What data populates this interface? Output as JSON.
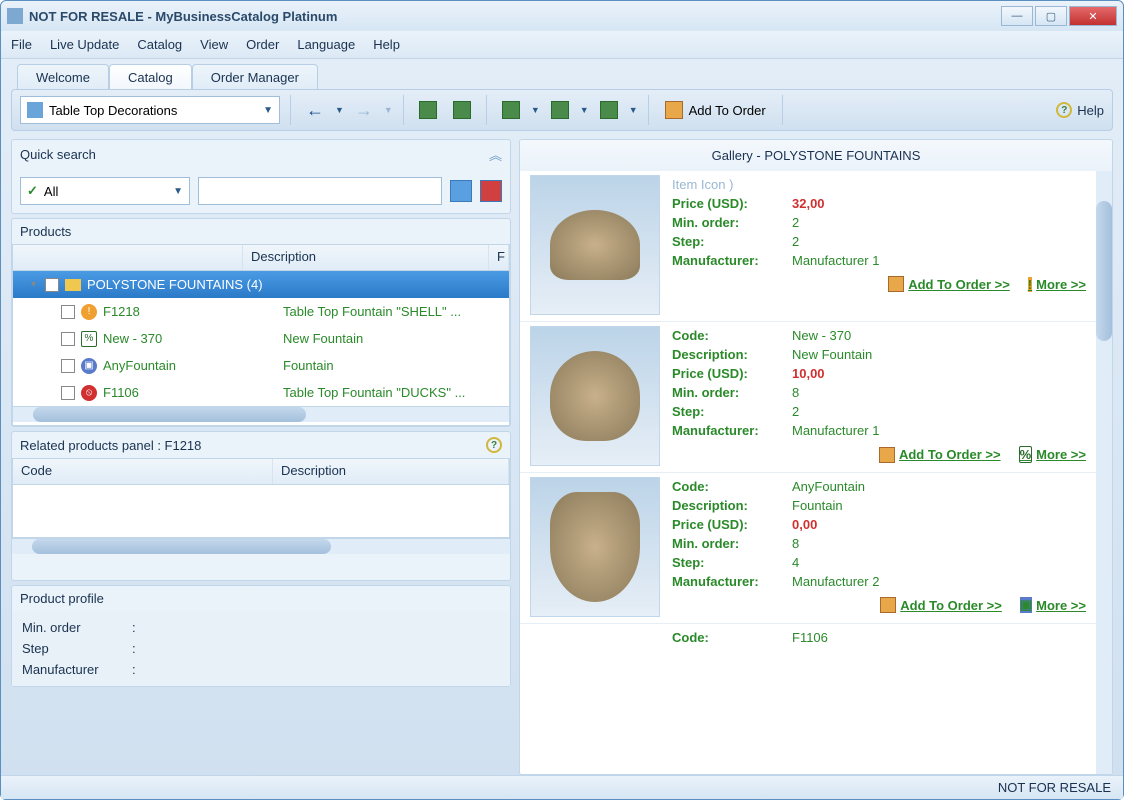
{
  "window": {
    "title": "NOT FOR RESALE - MyBusinessCatalog Platinum"
  },
  "menu": [
    "File",
    "Live Update",
    "Catalog",
    "View",
    "Order",
    "Language",
    "Help"
  ],
  "tabs": {
    "welcome": "Welcome",
    "catalog": "Catalog",
    "order_manager": "Order Manager"
  },
  "toolbar": {
    "category": "Table Top Decorations",
    "add_to_order": "Add To Order",
    "help": "Help"
  },
  "quick_search": {
    "title": "Quick search",
    "filter": "All"
  },
  "products": {
    "title": "Products",
    "col_name": "",
    "col_desc": "Description",
    "col_f": "F",
    "folder": "POLYSTONE FOUNTAINS   (4)",
    "rows": [
      {
        "code": "F1218",
        "desc": "Table Top Fountain \"SHELL\"   ...",
        "icon": "warn"
      },
      {
        "code": "New - 370",
        "desc": "New Fountain",
        "icon": "pct"
      },
      {
        "code": "AnyFountain",
        "desc": "Fountain",
        "icon": "ship"
      },
      {
        "code": "F1106",
        "desc": "Table Top Fountain \"DUCKS\"   ...",
        "icon": "stop"
      }
    ]
  },
  "related": {
    "title": "Related products panel : F1218",
    "col_code": "Code",
    "col_desc": "Description"
  },
  "profile": {
    "title": "Product profile",
    "min_order_label": "Min. order",
    "step_label": "Step",
    "manufacturer_label": "Manufacturer",
    "colon": ":"
  },
  "gallery": {
    "title": "Gallery - POLYSTONE FOUNTAINS",
    "labels": {
      "code": "Code:",
      "desc": "Description:",
      "price": "Price (USD):",
      "min": "Min. order:",
      "step": "Step:",
      "mfr": "Manufacturer:"
    },
    "add_to_order": "Add To Order >>",
    "more": "More >>",
    "partial_top": "Item Icon )",
    "items": [
      {
        "price": "32,00",
        "min": "2",
        "step": "2",
        "mfr": "Manufacturer 1"
      },
      {
        "code": "New - 370",
        "desc": "New Fountain",
        "price": "10,00",
        "min": "8",
        "step": "2",
        "mfr": "Manufacturer 1"
      },
      {
        "code": "AnyFountain",
        "desc": "Fountain",
        "price": "0,00",
        "min": "8",
        "step": "4",
        "mfr": "Manufacturer 2"
      }
    ],
    "peek_code_label": "Code:",
    "peek_code": "F1106"
  },
  "status": "NOT FOR RESALE"
}
